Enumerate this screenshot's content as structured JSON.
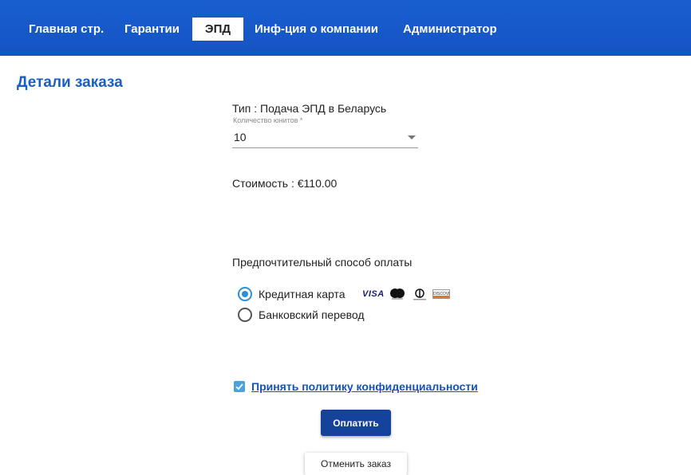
{
  "nav": {
    "items": [
      {
        "label": "Главная стр."
      },
      {
        "label": "Гарантии"
      },
      {
        "label": "ЭПД",
        "active": true
      },
      {
        "label": "Инф-ция о компании"
      },
      {
        "label": "Администратор"
      }
    ]
  },
  "page": {
    "title": "Детали заказа"
  },
  "order": {
    "type_line": "Тип : Подача ЭПД в Беларусь",
    "units_label": "Количество юнитов *",
    "units_value": "10",
    "cost_line": "Стоимость : €110.00"
  },
  "payment": {
    "title": "Предпочтительный способ оплаты",
    "options": [
      {
        "label": "Кредитная карта",
        "selected": true
      },
      {
        "label": "Банковский перевод",
        "selected": false
      }
    ],
    "card_logos": {
      "visa": "VISA",
      "discover": "DISCOVER"
    }
  },
  "privacy": {
    "checked": true,
    "link_label": "Принять политику конфиденциальности"
  },
  "actions": {
    "pay_label": "Оплатить",
    "cancel_label": "Отменить заказ"
  },
  "colors": {
    "navbar": "#1a5fd0",
    "title": "#1a5fc4",
    "radio_accent": "#2d8fd8",
    "checkbox": "#4aa3df",
    "pay_button": "#15429a"
  }
}
